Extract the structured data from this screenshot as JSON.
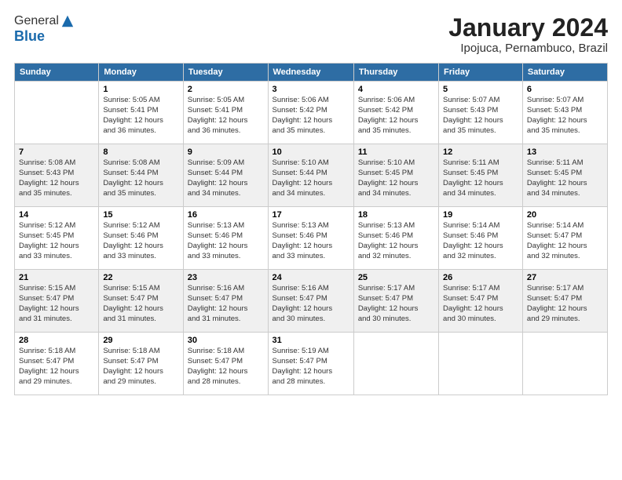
{
  "logo": {
    "general": "General",
    "blue": "Blue"
  },
  "header": {
    "title": "January 2024",
    "location": "Ipojuca, Pernambuco, Brazil"
  },
  "weekdays": [
    "Sunday",
    "Monday",
    "Tuesday",
    "Wednesday",
    "Thursday",
    "Friday",
    "Saturday"
  ],
  "weeks": [
    [
      {
        "day": "",
        "info": ""
      },
      {
        "day": "1",
        "info": "Sunrise: 5:05 AM\nSunset: 5:41 PM\nDaylight: 12 hours\nand 36 minutes."
      },
      {
        "day": "2",
        "info": "Sunrise: 5:05 AM\nSunset: 5:41 PM\nDaylight: 12 hours\nand 36 minutes."
      },
      {
        "day": "3",
        "info": "Sunrise: 5:06 AM\nSunset: 5:42 PM\nDaylight: 12 hours\nand 35 minutes."
      },
      {
        "day": "4",
        "info": "Sunrise: 5:06 AM\nSunset: 5:42 PM\nDaylight: 12 hours\nand 35 minutes."
      },
      {
        "day": "5",
        "info": "Sunrise: 5:07 AM\nSunset: 5:43 PM\nDaylight: 12 hours\nand 35 minutes."
      },
      {
        "day": "6",
        "info": "Sunrise: 5:07 AM\nSunset: 5:43 PM\nDaylight: 12 hours\nand 35 minutes."
      }
    ],
    [
      {
        "day": "7",
        "info": "Sunrise: 5:08 AM\nSunset: 5:43 PM\nDaylight: 12 hours\nand 35 minutes."
      },
      {
        "day": "8",
        "info": "Sunrise: 5:08 AM\nSunset: 5:44 PM\nDaylight: 12 hours\nand 35 minutes."
      },
      {
        "day": "9",
        "info": "Sunrise: 5:09 AM\nSunset: 5:44 PM\nDaylight: 12 hours\nand 34 minutes."
      },
      {
        "day": "10",
        "info": "Sunrise: 5:10 AM\nSunset: 5:44 PM\nDaylight: 12 hours\nand 34 minutes."
      },
      {
        "day": "11",
        "info": "Sunrise: 5:10 AM\nSunset: 5:45 PM\nDaylight: 12 hours\nand 34 minutes."
      },
      {
        "day": "12",
        "info": "Sunrise: 5:11 AM\nSunset: 5:45 PM\nDaylight: 12 hours\nand 34 minutes."
      },
      {
        "day": "13",
        "info": "Sunrise: 5:11 AM\nSunset: 5:45 PM\nDaylight: 12 hours\nand 34 minutes."
      }
    ],
    [
      {
        "day": "14",
        "info": "Sunrise: 5:12 AM\nSunset: 5:45 PM\nDaylight: 12 hours\nand 33 minutes."
      },
      {
        "day": "15",
        "info": "Sunrise: 5:12 AM\nSunset: 5:46 PM\nDaylight: 12 hours\nand 33 minutes."
      },
      {
        "day": "16",
        "info": "Sunrise: 5:13 AM\nSunset: 5:46 PM\nDaylight: 12 hours\nand 33 minutes."
      },
      {
        "day": "17",
        "info": "Sunrise: 5:13 AM\nSunset: 5:46 PM\nDaylight: 12 hours\nand 33 minutes."
      },
      {
        "day": "18",
        "info": "Sunrise: 5:13 AM\nSunset: 5:46 PM\nDaylight: 12 hours\nand 32 minutes."
      },
      {
        "day": "19",
        "info": "Sunrise: 5:14 AM\nSunset: 5:46 PM\nDaylight: 12 hours\nand 32 minutes."
      },
      {
        "day": "20",
        "info": "Sunrise: 5:14 AM\nSunset: 5:47 PM\nDaylight: 12 hours\nand 32 minutes."
      }
    ],
    [
      {
        "day": "21",
        "info": "Sunrise: 5:15 AM\nSunset: 5:47 PM\nDaylight: 12 hours\nand 31 minutes."
      },
      {
        "day": "22",
        "info": "Sunrise: 5:15 AM\nSunset: 5:47 PM\nDaylight: 12 hours\nand 31 minutes."
      },
      {
        "day": "23",
        "info": "Sunrise: 5:16 AM\nSunset: 5:47 PM\nDaylight: 12 hours\nand 31 minutes."
      },
      {
        "day": "24",
        "info": "Sunrise: 5:16 AM\nSunset: 5:47 PM\nDaylight: 12 hours\nand 30 minutes."
      },
      {
        "day": "25",
        "info": "Sunrise: 5:17 AM\nSunset: 5:47 PM\nDaylight: 12 hours\nand 30 minutes."
      },
      {
        "day": "26",
        "info": "Sunrise: 5:17 AM\nSunset: 5:47 PM\nDaylight: 12 hours\nand 30 minutes."
      },
      {
        "day": "27",
        "info": "Sunrise: 5:17 AM\nSunset: 5:47 PM\nDaylight: 12 hours\nand 29 minutes."
      }
    ],
    [
      {
        "day": "28",
        "info": "Sunrise: 5:18 AM\nSunset: 5:47 PM\nDaylight: 12 hours\nand 29 minutes."
      },
      {
        "day": "29",
        "info": "Sunrise: 5:18 AM\nSunset: 5:47 PM\nDaylight: 12 hours\nand 29 minutes."
      },
      {
        "day": "30",
        "info": "Sunrise: 5:18 AM\nSunset: 5:47 PM\nDaylight: 12 hours\nand 28 minutes."
      },
      {
        "day": "31",
        "info": "Sunrise: 5:19 AM\nSunset: 5:47 PM\nDaylight: 12 hours\nand 28 minutes."
      },
      {
        "day": "",
        "info": ""
      },
      {
        "day": "",
        "info": ""
      },
      {
        "day": "",
        "info": ""
      }
    ]
  ]
}
